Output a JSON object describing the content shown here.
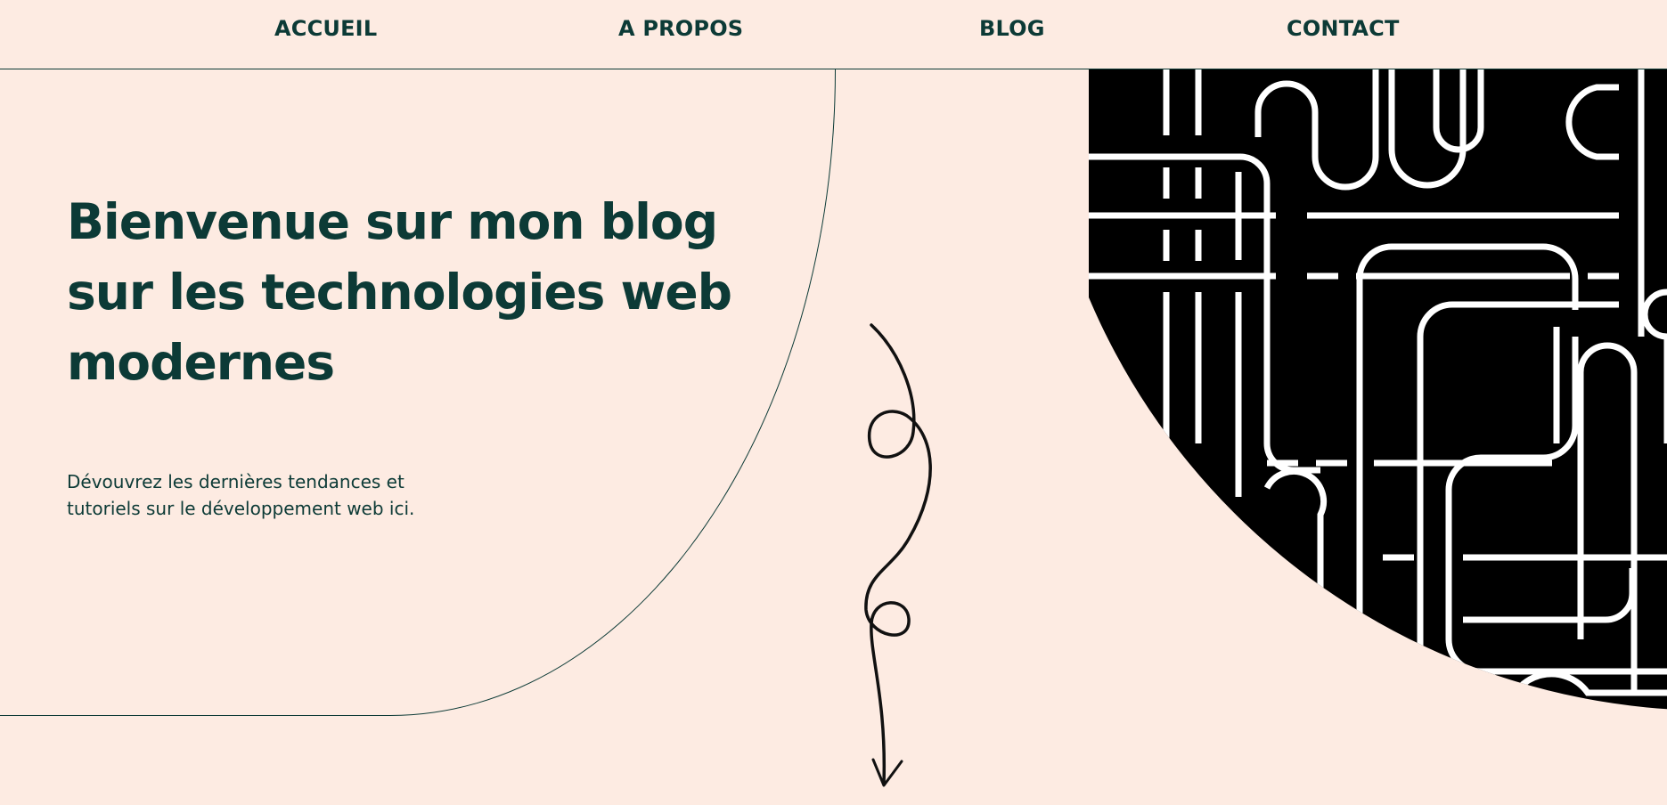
{
  "nav": {
    "items": [
      {
        "label": "ACCUEIL"
      },
      {
        "label": "A PROPOS"
      },
      {
        "label": "BLOG"
      },
      {
        "label": "CONTACT"
      }
    ]
  },
  "hero": {
    "title": "Bienvenue sur mon blog sur les technologies web modernes",
    "subtitle": "Dévouvrez les dernières tendances et tutoriels sur le développement web ici."
  },
  "colors": {
    "background": "#fdebe2",
    "text": "#0c3a36",
    "pattern": "#000000",
    "pattern_lines": "#ffffff"
  },
  "decorations": {
    "arrow": "hand-drawn-loop-arrow-down",
    "pattern": "circuit-maze-pattern"
  }
}
